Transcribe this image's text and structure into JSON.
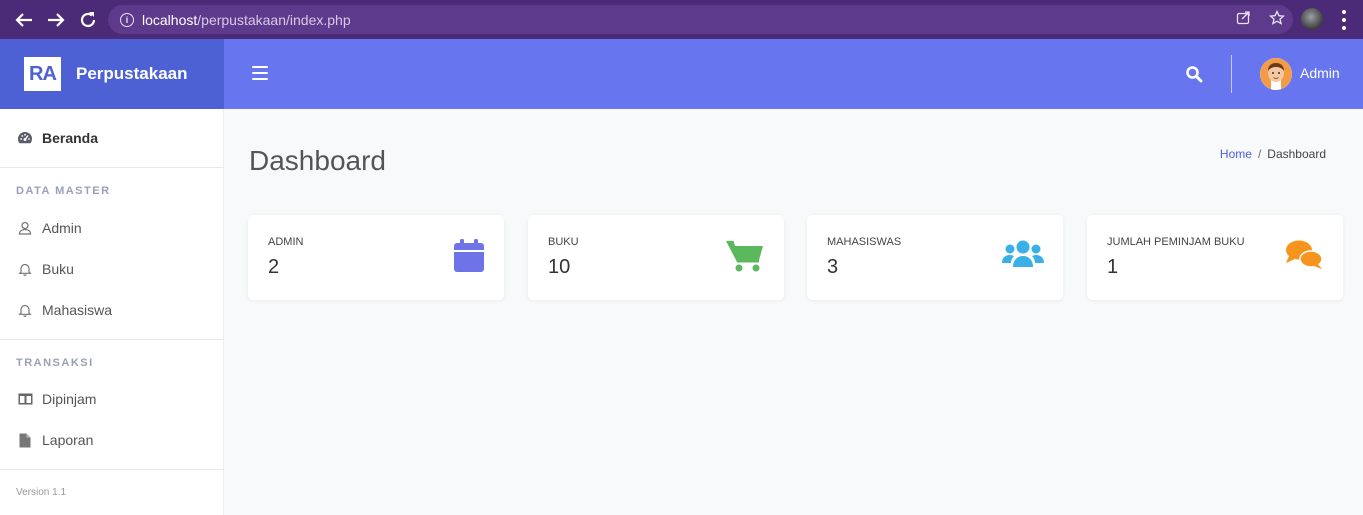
{
  "browser": {
    "url_host": "localhost",
    "url_path": "/perpustakaan/index.php"
  },
  "brand": {
    "logo_text": "RA",
    "name": "Perpustakaan",
    "color": "#4e61d4"
  },
  "topbar": {
    "user_name": "Admin",
    "color": "#6775ee"
  },
  "sidebar": {
    "home": {
      "label": "Beranda",
      "icon": "gauge-icon"
    },
    "section_master": "DATA MASTER",
    "master_items": [
      {
        "label": "Admin",
        "icon": "user-icon"
      },
      {
        "label": "Buku",
        "icon": "bell-icon"
      },
      {
        "label": "Mahasiswa",
        "icon": "bell-icon"
      }
    ],
    "section_transaksi": "TRANSAKSI",
    "transaksi_items": [
      {
        "label": "Dipinjam",
        "icon": "table-icon"
      },
      {
        "label": "Laporan",
        "icon": "file-icon"
      }
    ],
    "version": "Version 1.1"
  },
  "main": {
    "title": "Dashboard",
    "breadcrumb": {
      "home": "Home",
      "separator": "/",
      "current": "Dashboard"
    },
    "cards": [
      {
        "label": "ADMIN",
        "value": "2",
        "icon": "calendar-icon",
        "color": "#6e73e8"
      },
      {
        "label": "BUKU",
        "value": "10",
        "icon": "cart-icon",
        "color": "#5cb85c"
      },
      {
        "label": "MAHASISWAS",
        "value": "3",
        "icon": "users-icon",
        "color": "#3ab0e8"
      },
      {
        "label": "JUMLAH PEMINJAM BUKU",
        "value": "1",
        "icon": "comments-icon",
        "color": "#f7941d"
      }
    ]
  }
}
